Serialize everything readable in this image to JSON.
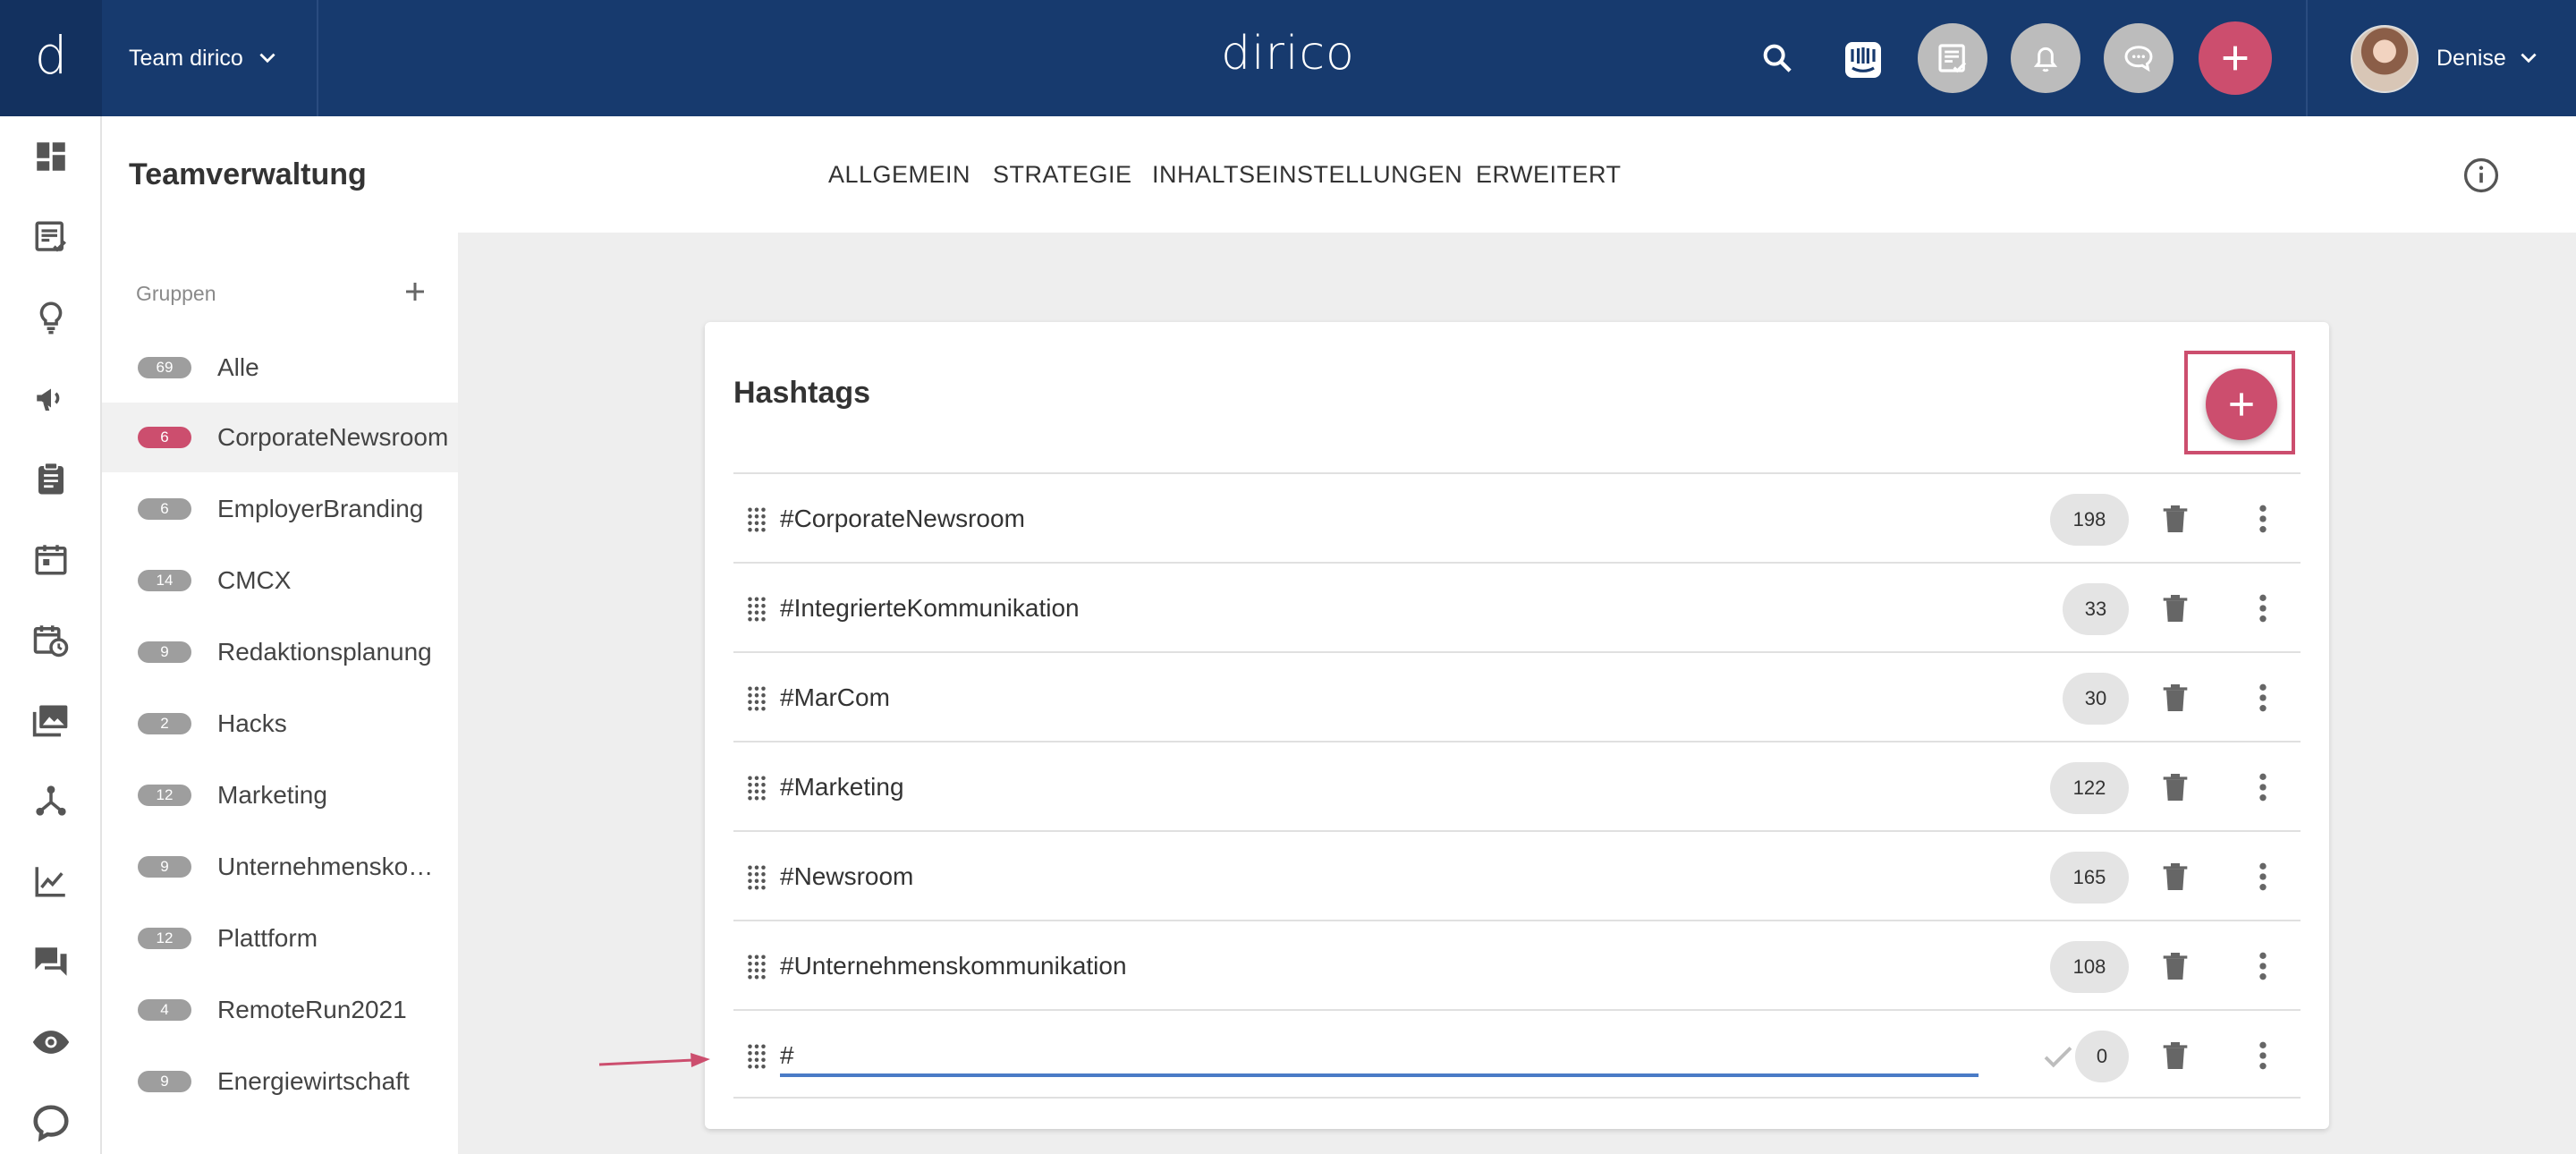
{
  "header": {
    "logo_glyph": "d",
    "team_label": "Team dirico",
    "brand": "dirico",
    "user_name": "Denise",
    "icons": [
      "search-icon",
      "intercom-icon",
      "tasks-icon",
      "bell-icon",
      "chat-icon",
      "plus-icon"
    ],
    "accent": "#cc4e6e",
    "bar_color": "#173a6e"
  },
  "rail": {
    "icons": [
      "dashboard-icon",
      "content-icon",
      "ideas-icon",
      "campaign-icon",
      "clipboard-icon",
      "calendar-icon",
      "schedule-icon",
      "media-icon",
      "network-icon",
      "analytics-icon",
      "comments-icon",
      "eye-icon",
      "help-icon"
    ]
  },
  "page": {
    "title": "Teamverwaltung",
    "tabs": [
      "ALLGEMEIN",
      "STRATEGIE",
      "INHALTSEINSTELLUNGEN",
      "ERWEITERT"
    ]
  },
  "groups": {
    "heading": "Gruppen",
    "items": [
      {
        "count": "69",
        "label": "Alle"
      },
      {
        "count": "6",
        "label": "CorporateNewsroom",
        "active": true
      },
      {
        "count": "6",
        "label": "EmployerBranding"
      },
      {
        "count": "14",
        "label": "CMCX"
      },
      {
        "count": "9",
        "label": "Redaktionsplanung"
      },
      {
        "count": "2",
        "label": "Hacks"
      },
      {
        "count": "12",
        "label": "Marketing"
      },
      {
        "count": "9",
        "label": "Unternehmenskom…"
      },
      {
        "count": "12",
        "label": "Plattform"
      },
      {
        "count": "4",
        "label": "RemoteRun2021"
      },
      {
        "count": "9",
        "label": "Energiewirtschaft"
      }
    ]
  },
  "hashtags": {
    "title": "Hashtags",
    "rows": [
      {
        "label": "#CorporateNewsroom",
        "count": "198"
      },
      {
        "label": "#IntegrierteKommunikation",
        "count": "33"
      },
      {
        "label": "#MarCom",
        "count": "30"
      },
      {
        "label": "#Marketing",
        "count": "122"
      },
      {
        "label": "#Newsroom",
        "count": "165"
      },
      {
        "label": "#Unternehmenskommunikation",
        "count": "108"
      }
    ],
    "new_row": {
      "prefix": "#",
      "value": "",
      "count": "0"
    }
  }
}
